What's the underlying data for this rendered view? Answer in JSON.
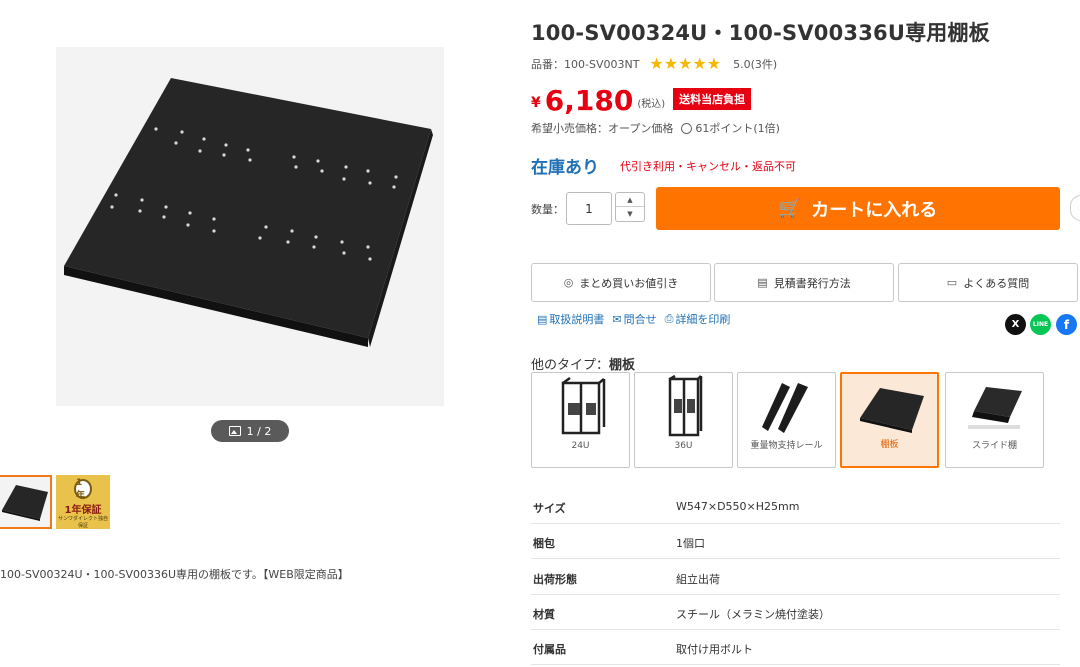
{
  "gallery": {
    "counter": "1 / 2",
    "thumb2": {
      "medal": "1年",
      "guarantee": "1年保証",
      "fineprint": "サンワダイレクト独自保証"
    }
  },
  "description": "100-SV00324U・100-SV00336U専用の棚板です。【WEB限定商品】",
  "product": {
    "title": "100-SV00324U・100-SV00336U専用棚板",
    "sku": "品番：100-SV003NT",
    "rating_stars": 5,
    "rating_text": "5.0(3件)",
    "yen": "¥",
    "price": "6,180",
    "tax": "(税込)",
    "shipping_badge": "送料当店負担",
    "msrp": "希望小売価格：オープン価格",
    "points": "61ポイント(1倍)",
    "stock": "在庫あり",
    "stock_note": "代引き利用・キャンセル・返品不可"
  },
  "purchase": {
    "qty_label": "数量：",
    "qty_value": "1",
    "cart_label": "カートに入れる"
  },
  "info_buttons": [
    {
      "label": "まとめ買いお値引き"
    },
    {
      "label": "見積書発行方法"
    },
    {
      "label": "よくある質問"
    }
  ],
  "links": [
    {
      "label": "取扱説明書"
    },
    {
      "label": "問合せ"
    },
    {
      "label": "詳細を印刷"
    }
  ],
  "social": {
    "x": "X",
    "line": "LINE",
    "fb": "f"
  },
  "types": {
    "label_prefix": "他のタイプ：",
    "label_current": "棚板",
    "items": [
      {
        "label": "24U"
      },
      {
        "label": "36U"
      },
      {
        "label": "重量物支持レール"
      },
      {
        "label": "棚板",
        "selected": true
      },
      {
        "label": "スライド棚"
      }
    ]
  },
  "specs": [
    {
      "key": "サイズ",
      "value": "W547×D550×H25mm"
    },
    {
      "key": "梱包",
      "value": "1個口"
    },
    {
      "key": "出荷形態",
      "value": "組立出荷"
    },
    {
      "key": "材質",
      "value": "スチール（メラミン焼付塗装）"
    },
    {
      "key": "付属品",
      "value": "取付け用ボルト"
    }
  ],
  "colors": {
    "accent": "#ff7300",
    "price_red": "#e60012",
    "stock_blue": "#1f6fb5",
    "star": "#f5b800"
  }
}
